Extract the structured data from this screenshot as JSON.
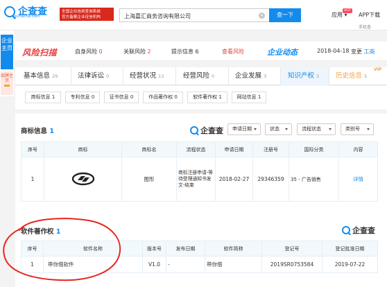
{
  "header": {
    "logo_text": "企查查",
    "logo_sub": "qichacha.com",
    "slogan_line1": "全国企业信用查询系统",
    "slogan_line2": "官方备案企业征信机构",
    "search_value": "上海嘉汇商务咨询有限公司",
    "search_button": "查一下",
    "nav_app": "应用",
    "hot_badge": "HOT",
    "nav_download": "APP下载",
    "nav_download_partial": "手机查"
  },
  "sidebar": {
    "main": "企业主页",
    "brand": "品牌主页"
  },
  "riskbar": {
    "logo": "风险扫描",
    "items": [
      {
        "label": "自身风险",
        "count": "0"
      },
      {
        "label": "关联风险",
        "count": "2"
      },
      {
        "label": "提示信息",
        "count": "6"
      }
    ],
    "look": "查看风险",
    "dyn_logo": "企业动态",
    "dyn_date": "2018-04-18",
    "dyn_text": "变更",
    "dyn_text_blue": "工商"
  },
  "tabs": [
    {
      "label": "基本信息",
      "count": "29"
    },
    {
      "label": "法律诉讼",
      "count": "0"
    },
    {
      "label": "经营状况",
      "count": "13"
    },
    {
      "label": "经营风险",
      "count": "0"
    },
    {
      "label": "企业发展",
      "count": "3"
    },
    {
      "label": "知识产权",
      "count": "3"
    },
    {
      "label": "历史信息",
      "count": "5"
    }
  ],
  "vip_badge": "VIP",
  "subtabs": [
    "商标信息 1",
    "专利信息 0",
    "证书信息 0",
    "作品著作权 0",
    "软件著作权 1",
    "网站信息 1"
  ],
  "trademark": {
    "title": "商标信息",
    "count": "1",
    "stamp": "企查查",
    "filters": [
      "申请日期",
      "状态",
      "流程状态",
      "类别号"
    ],
    "columns": [
      "序号",
      "商标",
      "商标名",
      "流程状态",
      "申请日期",
      "注册号",
      "国际分类",
      "内容"
    ],
    "rows": [
      {
        "no": "1",
        "name": "图形",
        "status": "商标注册申请-等待受理通知书发文-结束",
        "date": "2018-02-27",
        "reg": "29346359",
        "class": "35 - 广告销售",
        "action": "详情"
      }
    ]
  },
  "software": {
    "title": "软件著作权",
    "count": "1",
    "stamp": "企查查",
    "columns": [
      "序号",
      "软件名称",
      "版本号",
      "发布日期",
      "软件简称",
      "登记号",
      "登记批准日期"
    ],
    "rows": [
      {
        "no": "1",
        "name": "带你借软件",
        "version": "V1.0",
        "pub": "-",
        "short": "带你借",
        "reg": "2019SR0753584",
        "approve": "2019-07-22"
      }
    ]
  },
  "colors": {
    "accent": "#128bed",
    "risk": "#e83b3b",
    "annotation": "#e8231d"
  }
}
